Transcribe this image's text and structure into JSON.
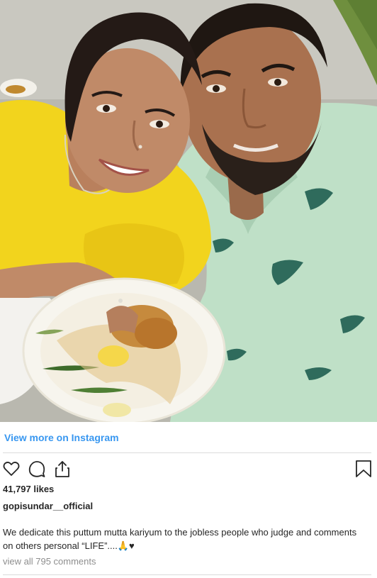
{
  "post": {
    "view_more_label": "View more on Instagram",
    "likes_text": "41,797 likes",
    "username": "gopisundar__official",
    "caption": "We dedicate this puttum mutta kariyum to the jobless people who judge and comments on others personal “LIFE”....🙏♥",
    "comments_link": "view all 795 comments"
  },
  "actions": {
    "like_icon": "heart-icon",
    "comment_icon": "comment-icon",
    "share_icon": "share-icon",
    "save_icon": "bookmark-icon"
  },
  "colors": {
    "link_blue": "#3897f0",
    "text_primary": "#262626",
    "text_secondary": "#8e8e8e",
    "divider": "#dbdbdb"
  }
}
